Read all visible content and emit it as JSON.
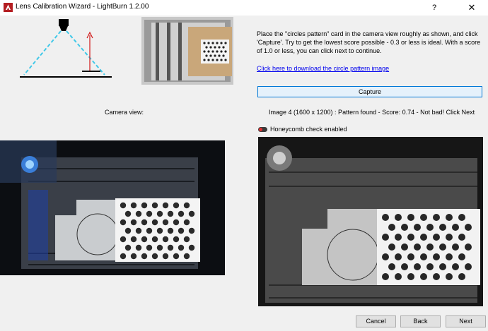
{
  "window": {
    "title": "Lens Calibration Wizard - LightBurn 1.2.00",
    "help_label": "?",
    "close_label": "✕"
  },
  "instructions": {
    "text": "Place the \"circles pattern\" card in the camera view roughly as shown, and click 'Capture'. Try to get the lowest score possible - 0.3 or less is ideal.  With a score of 1.0 or less, you can click next to continue.",
    "download_link": "Click here to download the circle pattern image"
  },
  "capture_label": "Capture",
  "camera_view_label": "Camera view:",
  "status": "Image 4 (1600 x 1200) : Pattern found - Score: 0.74 - Not bad! Click Next",
  "honeycomb": {
    "label": "Honeycomb check enabled",
    "enabled": true
  },
  "buttons": {
    "cancel": "Cancel",
    "back": "Back",
    "next": "Next"
  },
  "colors": {
    "accent": "#0078d7",
    "link": "#0000ee",
    "toggle_on": "#e03030",
    "diagram_cone": "#40c8e8",
    "diagram_arrow": "#d01818"
  },
  "icons": {
    "app": "lightburn-logo-icon",
    "help": "question-mark-icon",
    "close": "close-icon"
  }
}
